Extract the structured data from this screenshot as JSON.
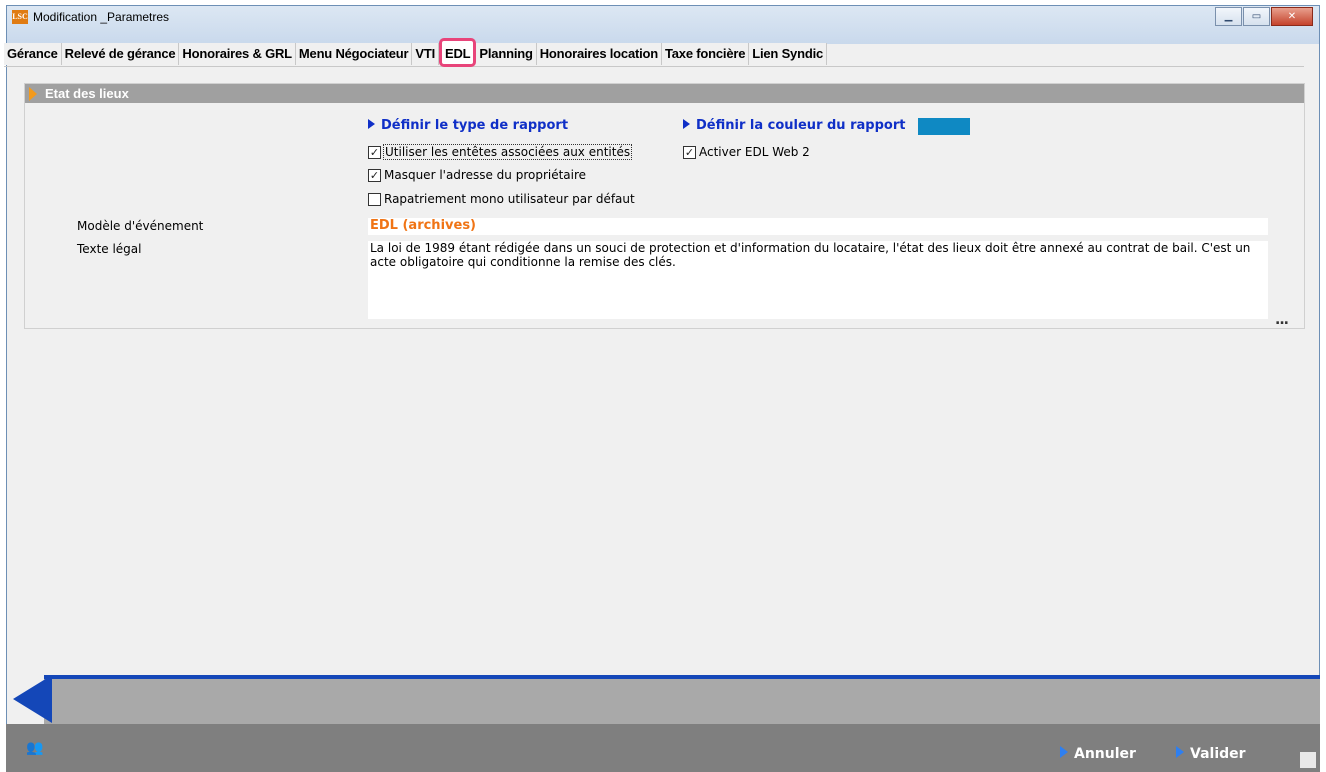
{
  "window": {
    "icon_text": "LSC",
    "title": "Modification _Parametres",
    "controls": [
      "minimize",
      "maximize",
      "close"
    ]
  },
  "tabs": [
    {
      "label": "Gérance",
      "active": false
    },
    {
      "label": "Relevé de gérance",
      "active": false
    },
    {
      "label": "Honoraires & GRL",
      "active": false
    },
    {
      "label": "Menu Négociateur",
      "active": false
    },
    {
      "label": "VTI",
      "active": false
    },
    {
      "label": "EDL",
      "active": true
    },
    {
      "label": "Planning",
      "active": false
    },
    {
      "label": "Honoraires location",
      "active": false
    },
    {
      "label": "Taxe foncière",
      "active": false
    },
    {
      "label": "Lien Syndic",
      "active": false
    }
  ],
  "section": {
    "title": "Etat des lieux",
    "report_type_heading": "Définir le type de rapport",
    "report_color_heading": "Définir la couleur du rapport",
    "report_color": "#0f89c3",
    "checkboxes": [
      {
        "label": "Utiliser les entêtes associées aux entités",
        "checked": true
      },
      {
        "label": "Masquer l'adresse du propriétaire",
        "checked": true
      },
      {
        "label": "Rapatriement mono utilisateur par défaut",
        "checked": false
      }
    ],
    "edl_web": {
      "label": "Activer EDL Web 2",
      "checked": true
    },
    "event_model_label": "Modèle d'événement",
    "event_model_value": "EDL (archives)",
    "legal_text_label": "Texte légal",
    "legal_text_value": "La loi de 1989 étant rédigée dans un souci de protection et d'information du locataire, l'état des lieux doit être annexé au contrat de bail. C'est un acte obligatoire qui conditionne la remise des clés.",
    "more_button": "..."
  },
  "footer": {
    "cancel_label": "Annuler",
    "validate_label": "Valider"
  }
}
